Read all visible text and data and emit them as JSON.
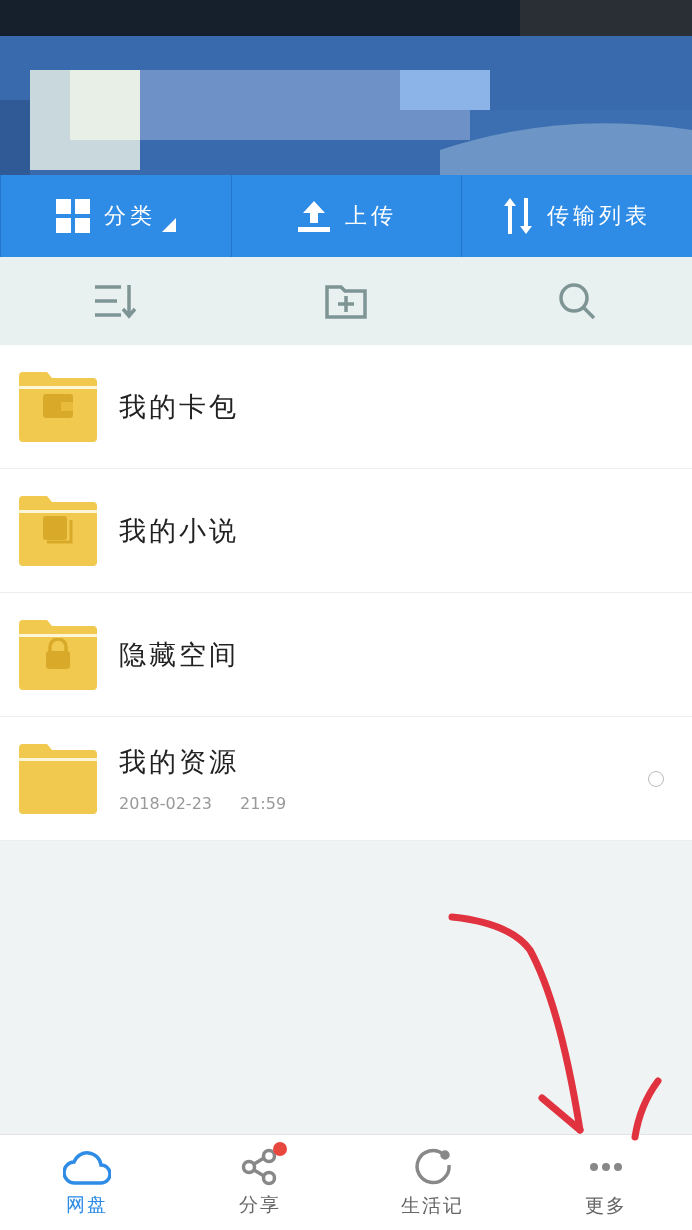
{
  "actions": [
    {
      "label": "分类",
      "caret": true
    },
    {
      "label": "上传",
      "caret": false
    },
    {
      "label": "传输列表",
      "caret": false
    }
  ],
  "files": [
    {
      "name": "我的卡包"
    },
    {
      "name": "我的小说"
    },
    {
      "name": "隐藏空间"
    },
    {
      "name": "我的资源",
      "date": "2018-02-23",
      "time": "21:59",
      "checked": false
    }
  ],
  "annotation": {
    "kind": "arrow"
  },
  "nav": [
    {
      "label": "网盘",
      "selected": true,
      "dot": false
    },
    {
      "label": "分享",
      "selected": false,
      "dot": true
    },
    {
      "label": "生活记",
      "selected": false,
      "dot": false
    },
    {
      "label": "更多",
      "selected": false,
      "dot": false
    }
  ]
}
